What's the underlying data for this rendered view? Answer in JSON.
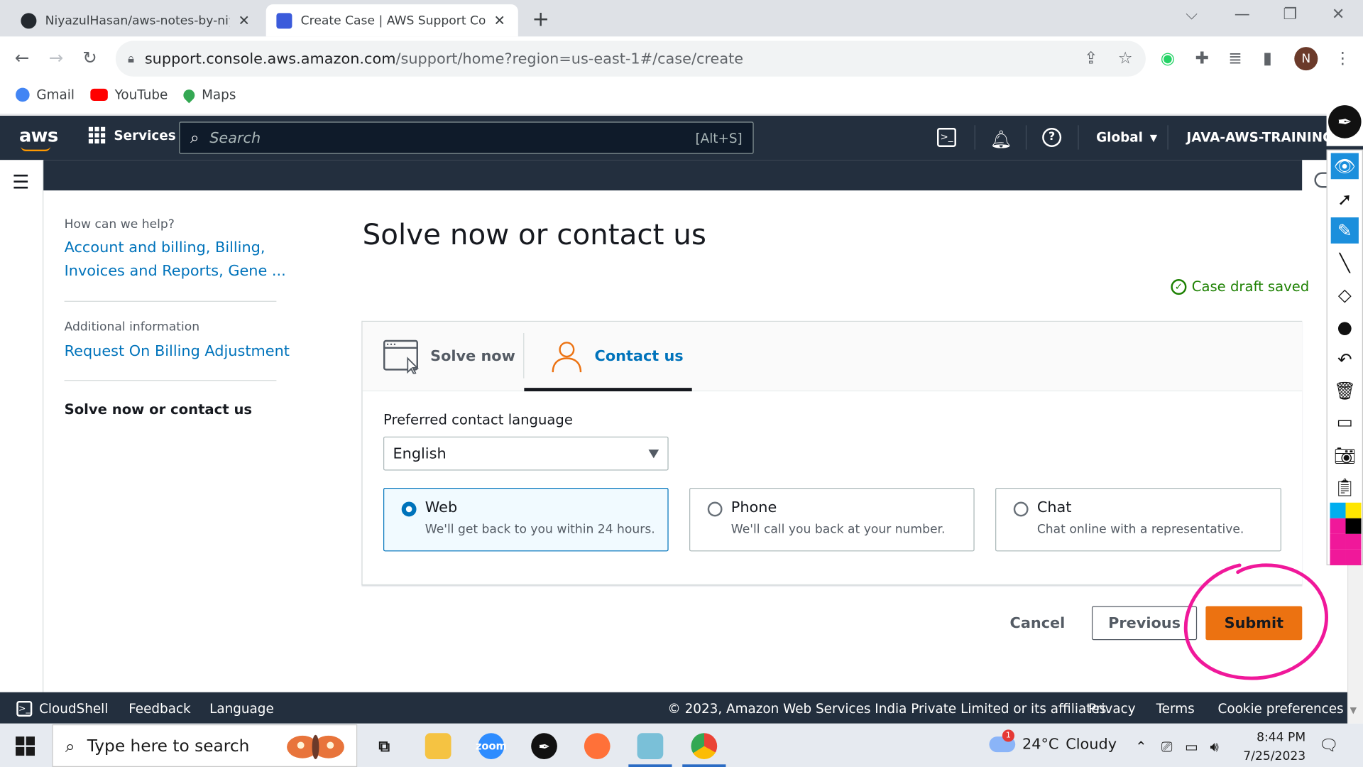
{
  "browser": {
    "tabs": [
      {
        "title": "NiyazulHasan/aws-notes-by-niya",
        "active": false
      },
      {
        "title": "Create Case | AWS Support Cons",
        "active": true
      }
    ],
    "url_host": "support.console.aws.amazon.com",
    "url_path": "/support/home?region=us-east-1#/case/create",
    "profile_initial": "N",
    "bookmarks": [
      "Gmail",
      "YouTube",
      "Maps"
    ]
  },
  "aws_header": {
    "logo": "aws",
    "services_label": "Services",
    "search_placeholder": "Search",
    "search_shortcut": "[Alt+S]",
    "region": "Global",
    "account": "JAVA-AWS-TRAINING"
  },
  "steps": {
    "step1_caption": "How can we help?",
    "step1_line1": "Account and billing, Billing,",
    "step1_line2": "Invoices and Reports, Gene ...",
    "step2_caption": "Additional information",
    "step2_link": "Request On Billing Adjustment",
    "step3_current": "Solve now or contact us"
  },
  "main": {
    "title": "Solve now or contact us",
    "draft_status": "Case draft saved",
    "tabs": [
      {
        "label": "Solve now",
        "selected": false
      },
      {
        "label": "Contact us",
        "selected": true
      }
    ],
    "language_label": "Preferred contact language",
    "language_value": "English",
    "contact_options": [
      {
        "title": "Web",
        "desc": "We'll get back to you within 24 hours.",
        "selected": true
      },
      {
        "title": "Phone",
        "desc": "We'll call you back at your number.",
        "selected": false
      },
      {
        "title": "Chat",
        "desc": "Chat online with a representative.",
        "selected": false
      }
    ],
    "buttons": {
      "cancel": "Cancel",
      "previous": "Previous",
      "submit": "Submit"
    }
  },
  "footer": {
    "cloudshell": "CloudShell",
    "feedback": "Feedback",
    "language": "Language",
    "copyright": "© 2023, Amazon Web Services India Private Limited or its affiliates.",
    "privacy": "Privacy",
    "terms": "Terms",
    "cookie": "Cookie preferences"
  },
  "taskbar": {
    "search_placeholder": "Type here to search",
    "weather_temp": "24°C",
    "weather_text": "Cloudy",
    "weather_badge": "1",
    "time": "8:44 PM",
    "date": "7/25/2023"
  },
  "colors": {
    "aws_navy": "#232f3e",
    "aws_orange": "#ec7211",
    "link_blue": "#0073bb",
    "success_green": "#1d8102",
    "annotation_pink": "#f0189a"
  }
}
